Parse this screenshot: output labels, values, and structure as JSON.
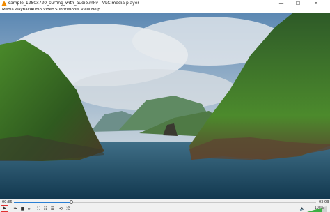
{
  "window": {
    "title": "sample_1280x720_surfing_with_audio.mkv - VLC media player",
    "minimize_glyph": "—",
    "maximize_glyph": "☐",
    "close_glyph": "✕"
  },
  "menu": [
    "Media",
    "Playback",
    "Audio",
    "Video",
    "Subtitle",
    "Tools",
    "View",
    "Help"
  ],
  "player": {
    "elapsed": "00:36",
    "total": "03:03",
    "progress": 0.19,
    "volume_label": "100%",
    "volume": 0.75,
    "accent_color": "#2a7fd4",
    "volume_color": "#3cb043"
  },
  "controls": {
    "play_glyph": "▶",
    "prev_glyph": "⏮",
    "stop_glyph": "■",
    "next_glyph": "⏭",
    "fullscreen_glyph": "⛶",
    "extended_glyph": "☷",
    "playlist_glyph": "☰",
    "loop_glyph": "⟲",
    "shuffle_glyph": "⤮",
    "volume_glyph": "🔈"
  }
}
